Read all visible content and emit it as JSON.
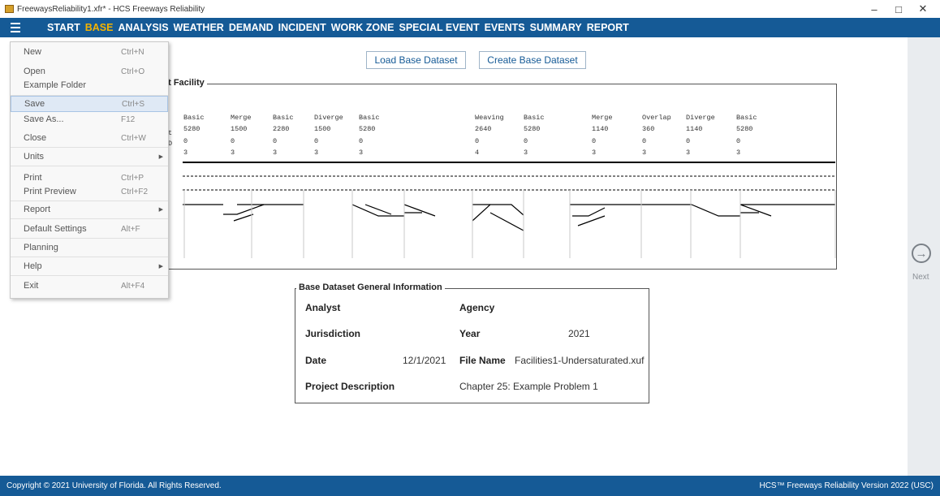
{
  "window": {
    "title": "FreewaysReliability1.xfr* - HCS Freeways Reliability",
    "minimize": "–",
    "maximize": "□",
    "close": "✕"
  },
  "menubar": {
    "items": [
      {
        "label": "START",
        "active": false
      },
      {
        "label": "BASE",
        "active": true
      },
      {
        "label": "ANALYSIS",
        "active": false
      },
      {
        "label": "WEATHER",
        "active": false
      },
      {
        "label": "DEMAND",
        "active": false
      },
      {
        "label": "INCIDENT",
        "active": false
      },
      {
        "label": "WORK ZONE",
        "active": false
      },
      {
        "label": "SPECIAL EVENT",
        "active": false
      },
      {
        "label": "EVENTS",
        "active": false
      },
      {
        "label": "SUMMARY",
        "active": false
      },
      {
        "label": "REPORT",
        "active": false
      }
    ]
  },
  "buttons": {
    "load": "Load Base Dataset",
    "create": "Create Base Dataset"
  },
  "facility": {
    "title": "et Facility",
    "row_labels": [
      "t",
      "D"
    ],
    "segments": [
      {
        "type": "Basic",
        "length": "5280",
        "a": "0",
        "lanes": "3"
      },
      {
        "type": "Merge",
        "length": "1500",
        "a": "0",
        "lanes": "3"
      },
      {
        "type": "Basic",
        "length": "2280",
        "a": "0",
        "lanes": "3"
      },
      {
        "type": "Diverge",
        "length": "1500",
        "a": "0",
        "lanes": "3"
      },
      {
        "type": "Basic",
        "length": "5280",
        "a": "0",
        "lanes": "3"
      },
      {
        "type": "Weaving",
        "length": "2640",
        "a": "0",
        "lanes": "4"
      },
      {
        "type": "Basic",
        "length": "5280",
        "a": "0",
        "lanes": "3"
      },
      {
        "type": "Merge",
        "length": "1140",
        "a": "0",
        "lanes": "3"
      },
      {
        "type": "Overlap",
        "length": "360",
        "a": "0",
        "lanes": "3"
      },
      {
        "type": "Diverge",
        "length": "1140",
        "a": "0",
        "lanes": "3"
      },
      {
        "type": "Basic",
        "length": "5280",
        "a": "0",
        "lanes": "3"
      }
    ]
  },
  "info": {
    "title": "Base Dataset General Information",
    "analyst_label": "Analyst",
    "analyst_value": "",
    "agency_label": "Agency",
    "agency_value": "",
    "jurisdiction_label": "Jurisdiction",
    "jurisdiction_value": "",
    "year_label": "Year",
    "year_value": "2021",
    "date_label": "Date",
    "date_value": "12/1/2021",
    "filename_label": "File Name",
    "filename_value": "Facilities1-Undersaturated.xuf",
    "project_label": "Project Description",
    "project_value": "Chapter 25: Example Problem 1"
  },
  "file_menu": {
    "items": [
      {
        "label": "New",
        "shortcut": "Ctrl+N",
        "submenu": false,
        "selected": false
      },
      {
        "label": "Open",
        "shortcut": "Ctrl+O",
        "submenu": false,
        "selected": false
      },
      {
        "label": "Example Folder",
        "shortcut": "",
        "submenu": false,
        "selected": false
      },
      {
        "label": "Save",
        "shortcut": "Ctrl+S",
        "submenu": false,
        "selected": true
      },
      {
        "label": "Save As...",
        "shortcut": "F12",
        "submenu": false,
        "selected": false
      },
      {
        "label": "Close",
        "shortcut": "Ctrl+W",
        "submenu": false,
        "selected": false
      },
      {
        "label": "Units",
        "shortcut": "",
        "submenu": true,
        "selected": false
      },
      {
        "label": "Print",
        "shortcut": "Ctrl+P",
        "submenu": false,
        "selected": false
      },
      {
        "label": "Print Preview",
        "shortcut": "Ctrl+F2",
        "submenu": false,
        "selected": false
      },
      {
        "label": "Report",
        "shortcut": "",
        "submenu": true,
        "selected": false
      },
      {
        "label": "Default Settings",
        "shortcut": "Alt+F",
        "submenu": false,
        "selected": false
      },
      {
        "label": "Planning",
        "shortcut": "",
        "submenu": false,
        "selected": false
      },
      {
        "label": "Help",
        "shortcut": "",
        "submenu": true,
        "selected": false
      },
      {
        "label": "Exit",
        "shortcut": "Alt+F4",
        "submenu": false,
        "selected": false
      }
    ]
  },
  "nav": {
    "next_label": "Next",
    "next_icon": "arrow-right-circle-icon"
  },
  "footer": {
    "copyright": "Copyright © 2021 University of Florida. All Rights Reserved.",
    "version": "HCS™ Freeways Reliability Version 2022 (USC)"
  },
  "colors": {
    "menubar": "#155a96",
    "active_menu": "#f5b300"
  }
}
